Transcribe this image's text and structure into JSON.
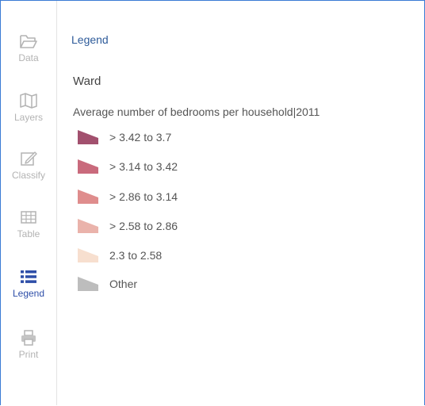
{
  "sidebar": {
    "items": [
      {
        "label": "Data",
        "icon": "folder-icon",
        "active": false
      },
      {
        "label": "Layers",
        "icon": "map-icon",
        "active": false
      },
      {
        "label": "Classify",
        "icon": "edit-icon",
        "active": false
      },
      {
        "label": "Table",
        "icon": "table-icon",
        "active": false
      },
      {
        "label": "Legend",
        "icon": "list-icon",
        "active": true
      },
      {
        "label": "Print",
        "icon": "printer-icon",
        "active": false
      }
    ]
  },
  "panel": {
    "title": "Legend",
    "group_title": "Ward",
    "variable_title": "Average number of bedrooms per household|2011",
    "entries": [
      {
        "label": "> 3.42 to 3.7",
        "color": "#a2506e"
      },
      {
        "label": "> 3.14 to 3.42",
        "color": "#c96a7c"
      },
      {
        "label": "> 2.86 to 3.14",
        "color": "#df8d8d"
      },
      {
        "label": "> 2.58 to 2.86",
        "color": "#eab3ab"
      },
      {
        "label": "2.3 to 2.58",
        "color": "#f7dfcf"
      },
      {
        "label": "Other",
        "color": "#bdbdbd"
      }
    ]
  },
  "colors": {
    "accent": "#2e4ea8",
    "frame": "#3a7bd5",
    "inactive": "#b3b3b3"
  }
}
